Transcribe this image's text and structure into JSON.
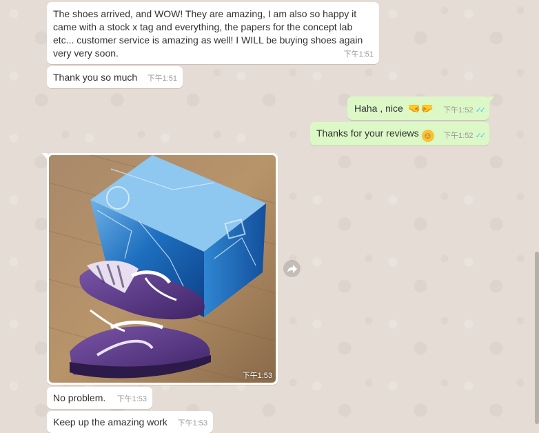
{
  "messages": {
    "m1": {
      "text": "The shoes arrived, and WOW! They are amazing, I am also so happy it came with a stock x tag and everything, the papers for the concept lab etc... customer service is amazing as well! I WILL be buying shoes again very very soon.",
      "time": "下午1:51"
    },
    "m2": {
      "text": "Thank you so much",
      "time": "下午1:51"
    },
    "m3": {
      "text": "Haha , nice",
      "emoji": "🤜🤛",
      "time": "下午1:52",
      "status": "✓✓"
    },
    "m4": {
      "text": "Thanks for your reviews",
      "emoji": "☺",
      "time": "下午1:52",
      "status": "✓✓"
    },
    "m5": {
      "type": "photo",
      "caption": "",
      "time": "下午1:53"
    },
    "m6": {
      "text": "No problem.",
      "time": "下午1:53"
    },
    "m7": {
      "text": "Keep up the amazing work",
      "time": "下午1:53"
    }
  },
  "icons": {
    "forward": "forward-arrow-icon",
    "read_receipt": "double-check-icon"
  },
  "colors": {
    "incoming_bubble": "#ffffff",
    "outgoing_bubble": "#dcf8c6",
    "chat_background": "#e5ddd5",
    "read_tick": "#4fc3f7"
  }
}
